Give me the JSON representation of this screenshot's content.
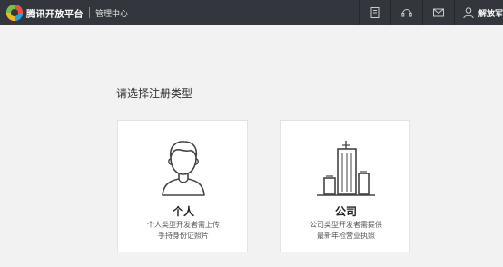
{
  "header": {
    "logo_text": "腾讯开放平台",
    "subtitle": "管理中心",
    "icons": [
      "document-icon",
      "headset-icon",
      "mail-icon",
      "user-icon"
    ],
    "user_label": "解放军"
  },
  "main": {
    "title": "请选择注册类型",
    "cards": [
      {
        "icon": "person-icon",
        "title": "个人",
        "desc1": "个人类型开发者需上传",
        "desc2": "手持身份证照片"
      },
      {
        "icon": "building-icon",
        "title": "公司",
        "desc1": "公司类型开发者需提供",
        "desc2": "最新年检营业执照"
      }
    ]
  },
  "colors": {
    "topbar": "#33373d",
    "page_bg": "#f2f2f2",
    "card_bg": "#ffffff"
  }
}
